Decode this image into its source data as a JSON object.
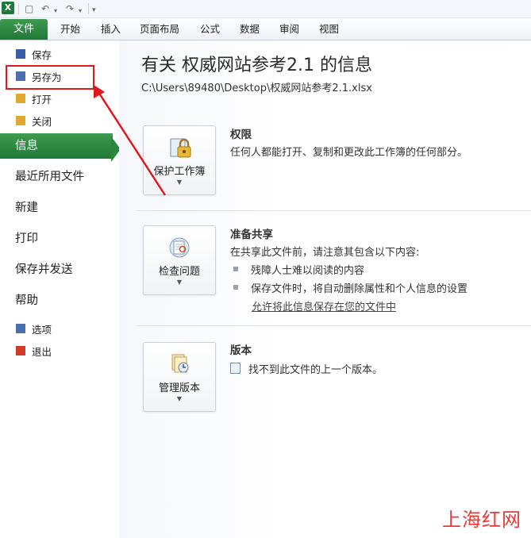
{
  "quick_access": {
    "app_icon_text": "X"
  },
  "ribbon": {
    "file_tab": "文件",
    "tabs": [
      "开始",
      "插入",
      "页面布局",
      "公式",
      "数据",
      "审阅",
      "视图"
    ]
  },
  "left_menu": {
    "small_top": [
      {
        "label": "保存",
        "icon": "save-icon",
        "color": "#3a5fa8"
      },
      {
        "label": "另存为",
        "icon": "save-as-icon",
        "color": "#4b6fb0"
      },
      {
        "label": "打开",
        "icon": "folder-open-icon",
        "color": "#e0a830"
      },
      {
        "label": "关闭",
        "icon": "folder-close-icon",
        "color": "#e0a830"
      }
    ],
    "big": [
      "信息",
      "最近所用文件",
      "新建",
      "打印",
      "保存并发送",
      "帮助"
    ],
    "active": "信息",
    "small_bottom": [
      {
        "label": "选项",
        "icon": "options-icon",
        "color": "#4a6fae"
      },
      {
        "label": "退出",
        "icon": "exit-icon",
        "color": "#d03a2a"
      }
    ]
  },
  "info": {
    "title": "有关 权威网站参考2.1 的信息",
    "path": "C:\\Users\\89480\\Desktop\\权威网站参考2.1.xlsx"
  },
  "sections": {
    "permissions": {
      "button": "保护工作簿",
      "heading": "权限",
      "desc": "任何人都能打开、复制和更改此工作簿的任何部分。"
    },
    "prepare": {
      "button": "检查问题",
      "heading": "准备共享",
      "desc": "在共享此文件前，请注意其包含以下内容:",
      "bullets": [
        "残障人士难以阅读的内容",
        "保存文件时，将自动删除属性和个人信息的设置"
      ],
      "link": "允许将此信息保存在您的文件中"
    },
    "versions": {
      "button": "管理版本",
      "heading": "版本",
      "desc": "找不到此文件的上一个版本。"
    }
  },
  "watermark": "上海红网",
  "colors": {
    "accent_green": "#2b8640",
    "annotation_red": "#e0181b"
  }
}
